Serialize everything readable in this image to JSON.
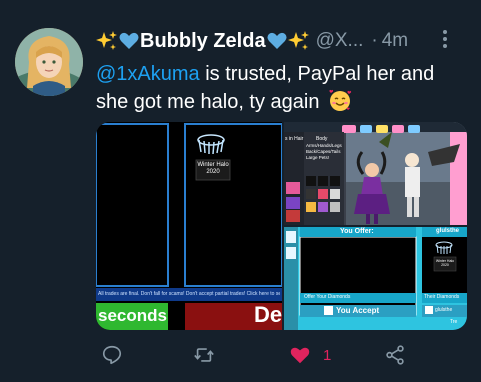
{
  "tweet": {
    "author": {
      "display_name": "Bubbly Zelda",
      "handle": "@X...",
      "name_icons": [
        "sparkles-icon",
        "blue-heart-icon",
        "blue-heart-icon",
        "sparkles-icon"
      ]
    },
    "separator": "·",
    "timestamp": "4m",
    "text": {
      "mention": "@1xAkuma",
      "line1_rest": " is trusted, PayPal her and",
      "line2": "she got me halo, ty again",
      "emoji": "smiling-face-with-hearts-icon"
    },
    "media": {
      "left": {
        "item_label_line1": "Winter Halo",
        "item_label_line2": "2020",
        "banner_text": "All trades are final. Don't fall for scams! Don't accept partial trades! Click here to see",
        "timer_text": "seconds",
        "right_text": "De"
      },
      "top_right": {
        "header_left": "s in Hair",
        "header_right": "Body",
        "category_text_1": "Arms/Hands/Legs",
        "category_text_2": "Back/Capes/Tails",
        "category_text_3": "Large Pets!"
      },
      "bottom_right": {
        "you_offer_label": "You Offer:",
        "partner_name": "glulsthe",
        "mini_item_label_1": "Winter Halo",
        "mini_item_label_2": "2020",
        "offer_diamonds_label": "Offer Your Diamonds",
        "their_diamonds_label": "Their Diamonds",
        "you_accept_label": "You Accept",
        "partner_accept_label": "glulsthe",
        "tre_text": "Tre"
      }
    },
    "actions": {
      "like_count": "1"
    },
    "colors": {
      "background": "#15202b",
      "accent_blue": "#1da1f2",
      "muted": "#8899a6",
      "like_pink": "#e0245e"
    }
  }
}
